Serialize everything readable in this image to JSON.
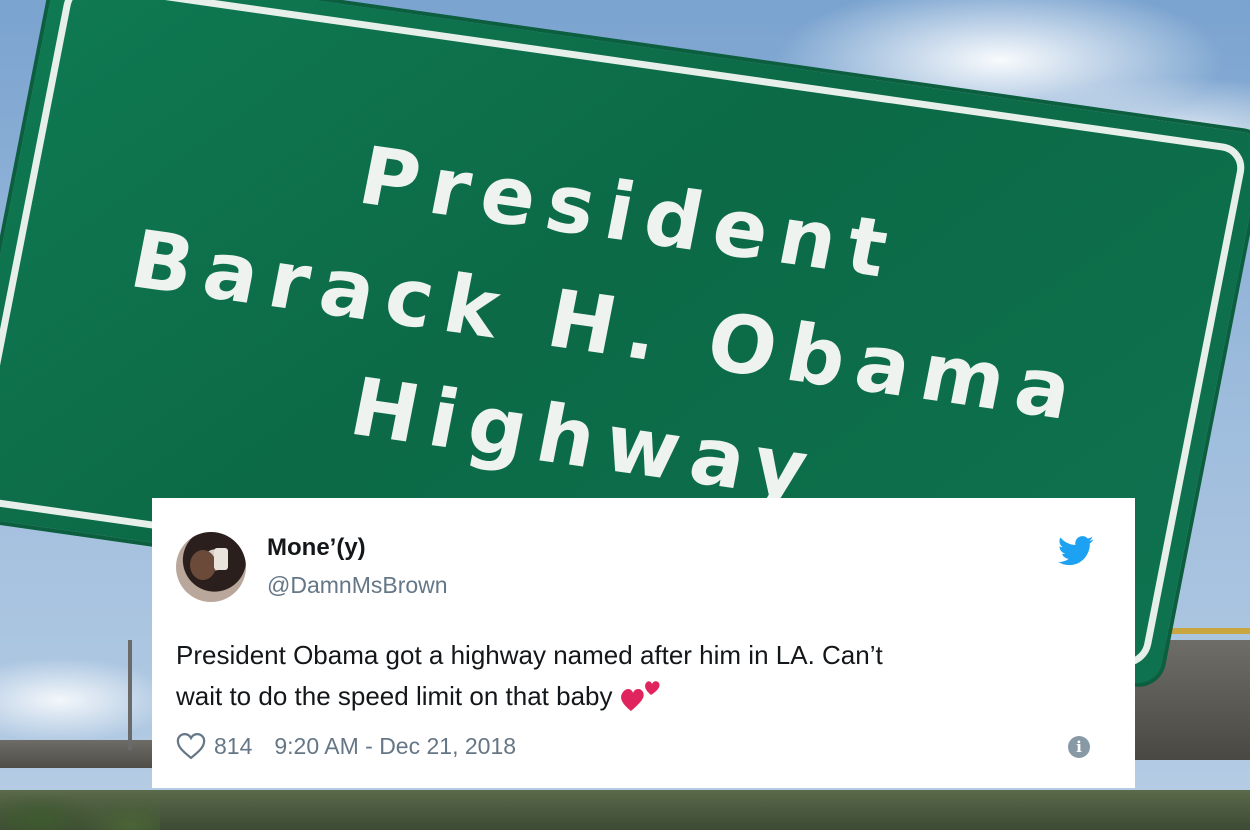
{
  "sign": {
    "line1": "President",
    "line2": "Barack H. Obama",
    "line3": "Highway"
  },
  "tweet": {
    "name": "Mone’(y)",
    "handle": "@DamnMsBrown",
    "text_line1": "President Obama got a highway named after him in LA. Can’t",
    "text_line2": "wait to do the speed limit on that baby",
    "emoji": "two-hearts-emoji",
    "likes": "814",
    "timestamp": "9:20 AM - Dec 21, 2018",
    "icons": {
      "brand": "twitter-bird-icon",
      "like": "heart-outline-icon",
      "info": "info-icon"
    },
    "colors": {
      "brand": "#1da1f2",
      "text": "#14171a",
      "muted": "#657786",
      "emoji_red": "#e0245e"
    }
  }
}
